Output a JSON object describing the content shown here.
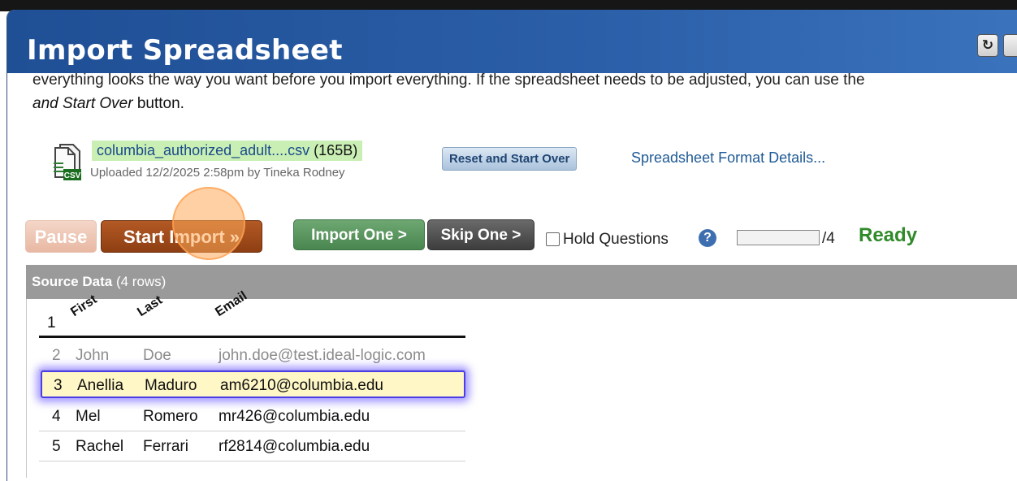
{
  "window": {
    "title": "Import Spreadsheet",
    "refresh_icon_glyph": "↻",
    "refresh_icon_name": "refresh-icon"
  },
  "intro": {
    "line1": "everything looks the way you want before you import everything. If the spreadsheet needs to be adjusted, you can use the",
    "line2_em": "and Start Over",
    "line2_rest": " button."
  },
  "file": {
    "name": "columbia_authorized_adult....csv",
    "size": "(165B)",
    "uploaded": "Uploaded 12/2/2025 2:58pm by Tineka Rodney",
    "badge": "CSV"
  },
  "actions": {
    "reset_label": "Reset and Start Over",
    "format_link": "Spreadsheet Format Details...",
    "pause_label": "Pause",
    "start_label": "Start Import »",
    "import_one_label": "Import One >",
    "skip_one_label": "Skip One >",
    "hold_label": "Hold Questions",
    "hold_checked": false,
    "help_glyph": "?",
    "progress_total": "/4",
    "progress_fraction": 0,
    "status": "Ready"
  },
  "source": {
    "title": "Source Data",
    "count": "(4 rows)",
    "header": {
      "num": "1",
      "columns": [
        "First",
        "Last",
        "Email"
      ]
    },
    "rows": [
      {
        "num": "2",
        "first": "John",
        "last": "Doe",
        "email": "john.doe@test.ideal-logic.com",
        "state": "done"
      },
      {
        "num": "3",
        "first": "Anellia",
        "last": "Maduro",
        "email": "am6210@columbia.edu",
        "state": "active"
      },
      {
        "num": "4",
        "first": "Mel",
        "last": "Romero",
        "email": "mr426@columbia.edu",
        "state": "pending"
      },
      {
        "num": "5",
        "first": "Rachel",
        "last": "Ferrari",
        "email": "rf2814@columbia.edu",
        "state": "pending"
      }
    ]
  },
  "colors": {
    "titlebar": "#2a5ea7",
    "status_ready": "#2f8a2a",
    "start_button": "#a04a18",
    "import_one_button": "#5a965f",
    "highlight_row": "#fff7c6",
    "highlight_glow": "#4a3ee8"
  }
}
